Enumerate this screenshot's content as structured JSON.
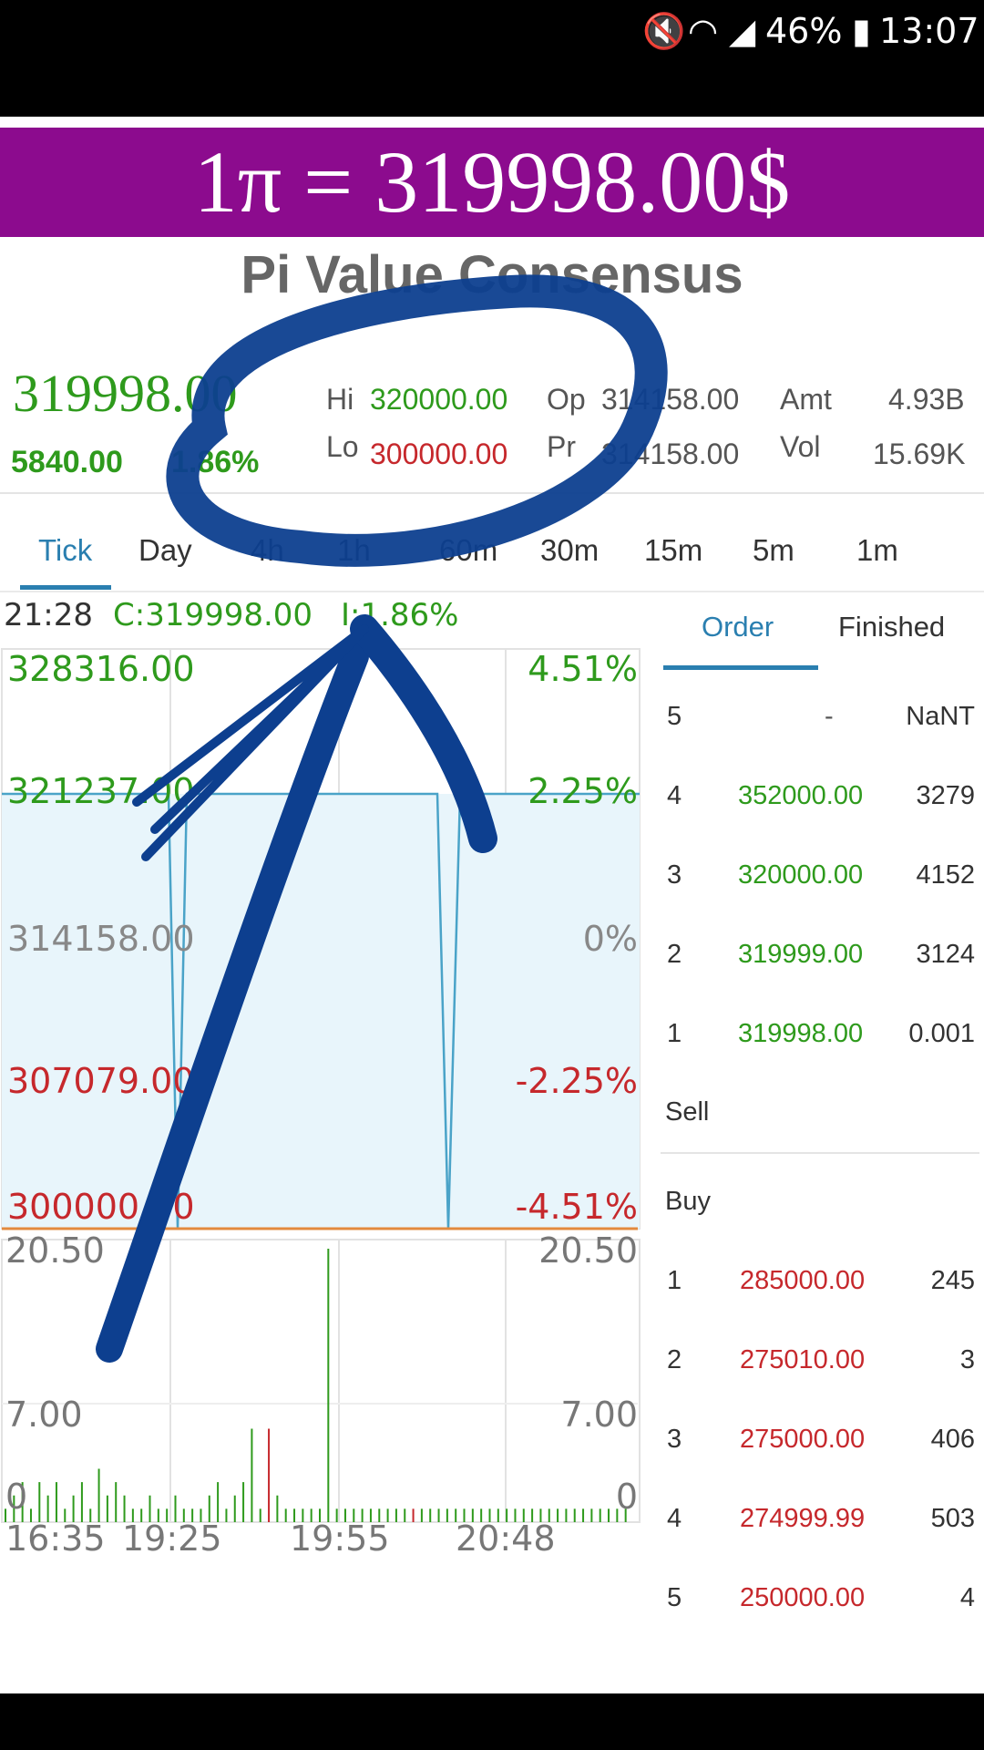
{
  "status_bar": {
    "battery": "46%",
    "time": "13:07"
  },
  "banner": {
    "text": "1π = 319998.00$"
  },
  "title": "Pi Value Consensus",
  "quote": {
    "price": "319998.00",
    "change": "5840.00",
    "change_pct": "1.86%",
    "hi_label": "Hi",
    "hi": "320000.00",
    "lo_label": "Lo",
    "lo": "300000.00",
    "op_label": "Op",
    "op": "314158.00",
    "pr_label": "Pr",
    "pr": "314158.00",
    "amt_label": "Amt",
    "amt": "4.93B",
    "vol_label": "Vol",
    "vol": "15.69K"
  },
  "tabs": [
    "Tick",
    "Day",
    "4h",
    "1h",
    "60m",
    "30m",
    "15m",
    "5m",
    "1m"
  ],
  "chart_info": {
    "time": "21:28",
    "close": "C:319998.00",
    "inc": "I:1.86%"
  },
  "price_axis_left": [
    "328316.00",
    "321237.00",
    "314158.00",
    "307079.00",
    "300000.00"
  ],
  "price_axis_right": [
    "4.51%",
    "2.25%",
    "0%",
    "-2.25%",
    "-4.51%"
  ],
  "volume_axis_left": [
    "20.50",
    "7.00",
    "0"
  ],
  "volume_axis_right": [
    "20.50",
    "7.00",
    "0"
  ],
  "time_axis": [
    "16:35",
    "19:25",
    "19:55",
    "20:48"
  ],
  "order_tabs": {
    "order": "Order",
    "finished": "Finished"
  },
  "sell": [
    {
      "level": "5",
      "price": "-",
      "qty": "NaNT"
    },
    {
      "level": "4",
      "price": "352000.00",
      "qty": "3279"
    },
    {
      "level": "3",
      "price": "320000.00",
      "qty": "4152"
    },
    {
      "level": "2",
      "price": "319999.00",
      "qty": "3124"
    },
    {
      "level": "1",
      "price": "319998.00",
      "qty": "0.001"
    }
  ],
  "sell_label": "Sell",
  "buy_label": "Buy",
  "buy": [
    {
      "level": "1",
      "price": "285000.00",
      "qty": "245"
    },
    {
      "level": "2",
      "price": "275010.00",
      "qty": "3"
    },
    {
      "level": "3",
      "price": "275000.00",
      "qty": "406"
    },
    {
      "level": "4",
      "price": "274999.99",
      "qty": "503"
    },
    {
      "level": "5",
      "price": "250000.00",
      "qty": "4"
    }
  ],
  "chart_data": {
    "type": "line",
    "title": "",
    "price_range": [
      300000.0,
      328316.0
    ],
    "reference_price": 314158.0,
    "volume_range": [
      0,
      20.5
    ],
    "x": [
      "16:35",
      "19:25",
      "19:55",
      "20:48"
    ],
    "series": [
      {
        "name": "",
        "values": [
          321237,
          321237,
          300000,
          321237,
          321237,
          321237,
          300000,
          321237,
          321237
        ]
      }
    ],
    "volume": [
      1,
      2,
      3,
      1,
      3,
      2,
      3,
      1,
      2,
      3,
      1,
      4,
      2,
      3,
      2,
      1,
      1,
      2,
      1,
      1,
      2,
      1,
      1,
      1,
      2,
      3,
      1,
      2,
      3,
      7,
      1,
      7,
      2,
      1,
      1,
      1,
      1,
      1,
      20.5,
      1,
      1,
      1,
      1,
      1,
      1,
      1,
      1,
      1,
      1,
      1,
      1,
      1,
      1,
      1,
      1,
      1,
      1,
      1,
      1,
      1,
      1,
      1,
      1,
      1,
      1,
      1,
      1,
      1,
      1,
      1,
      1,
      1,
      1,
      1
    ]
  },
  "colors": {
    "banner": "#8c0b8e",
    "up": "#2e9a1c",
    "down": "#c6282c",
    "accent": "#2a7fb0",
    "annotation": "#0d3f8f"
  }
}
